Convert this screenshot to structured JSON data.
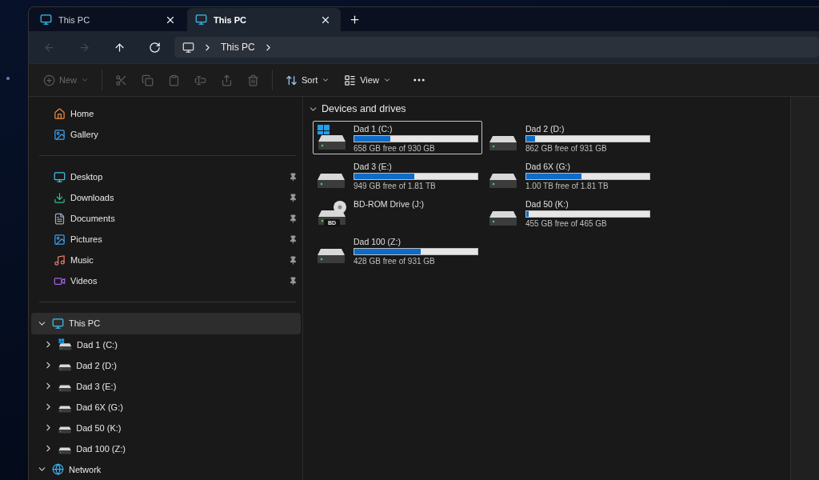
{
  "tabs": [
    {
      "title": "This PC",
      "selected": false
    },
    {
      "title": "This PC",
      "selected": true
    }
  ],
  "nav": [
    {
      "kind": "back",
      "disabled": true
    },
    {
      "kind": "forward",
      "disabled": true
    },
    {
      "kind": "up",
      "disabled": false
    },
    {
      "kind": "refresh",
      "disabled": false
    }
  ],
  "address": {
    "crumbs": [
      "This PC"
    ]
  },
  "toolbar": [
    {
      "kind": "new",
      "label": "New",
      "disabled": true
    },
    {
      "kind": "cut",
      "disabled": true
    },
    {
      "kind": "copy",
      "disabled": true
    },
    {
      "kind": "paste",
      "disabled": true
    },
    {
      "kind": "rename",
      "disabled": true
    },
    {
      "kind": "share",
      "disabled": true
    },
    {
      "kind": "delete",
      "disabled": true
    },
    {
      "kind": "sort",
      "label": "Sort",
      "disabled": false
    },
    {
      "kind": "view",
      "label": "View",
      "disabled": false
    },
    {
      "kind": "more",
      "disabled": false
    }
  ],
  "sidebar": {
    "quick": [
      {
        "kind": "home",
        "label": "Home"
      },
      {
        "kind": "gallery",
        "label": "Gallery"
      }
    ],
    "pinned": [
      {
        "kind": "desktop",
        "label": "Desktop",
        "pinned": true
      },
      {
        "kind": "downloads",
        "label": "Downloads",
        "pinned": true
      },
      {
        "kind": "documents",
        "label": "Documents",
        "pinned": true
      },
      {
        "kind": "pictures",
        "label": "Pictures",
        "pinned": true
      },
      {
        "kind": "music",
        "label": "Music",
        "pinned": true
      },
      {
        "kind": "videos",
        "label": "Videos",
        "pinned": true
      }
    ],
    "tree": [
      {
        "kind": "pc",
        "label": "This PC",
        "expanded": true,
        "selected": true,
        "children": [
          {
            "kind": "system",
            "label": "Dad 1 (C:)",
            "expanded": false,
            "selected": false
          },
          {
            "kind": "disk",
            "label": "Dad 2 (D:)",
            "expanded": false,
            "selected": false
          },
          {
            "kind": "disk",
            "label": "Dad 3 (E:)",
            "expanded": false,
            "selected": false
          },
          {
            "kind": "disk",
            "label": "Dad 6X (G:)",
            "expanded": false,
            "selected": false
          },
          {
            "kind": "disk",
            "label": "Dad 50 (K:)",
            "expanded": false,
            "selected": false
          },
          {
            "kind": "disk",
            "label": "Dad 100 (Z:)",
            "expanded": false,
            "selected": false
          }
        ]
      },
      {
        "kind": "network",
        "label": "Network",
        "expanded": true,
        "selected": false
      }
    ]
  },
  "content": {
    "section": {
      "title": "Devices and drives",
      "expanded": true
    },
    "drives": [
      {
        "kind": "system",
        "name": "Dad 1 (C:)",
        "level": 0.29,
        "space": "658 GB free of 930 GB",
        "selected": true
      },
      {
        "kind": "disk",
        "name": "Dad 2 (D:)",
        "level": 0.07,
        "space": "862 GB free of 931 GB",
        "selected": false
      },
      {
        "kind": "disk",
        "name": "Dad 3 (E:)",
        "level": 0.49,
        "space": "949 GB free of 1.81 TB",
        "selected": false
      },
      {
        "kind": "disk",
        "name": "Dad 6X (G:)",
        "level": 0.45,
        "space": "1.00 TB free of 1.81 TB",
        "selected": false
      },
      {
        "kind": "optical",
        "name": "BD-ROM Drive (J:)",
        "badge": "BD",
        "selected": false
      },
      {
        "kind": "disk",
        "name": "Dad 50 (K:)",
        "level": 0.02,
        "space": "455 GB free of 465 GB",
        "selected": false
      },
      {
        "kind": "disk",
        "name": "Dad 100 (Z:)",
        "level": 0.54,
        "space": "428 GB free of 931 GB",
        "selected": false
      }
    ]
  }
}
